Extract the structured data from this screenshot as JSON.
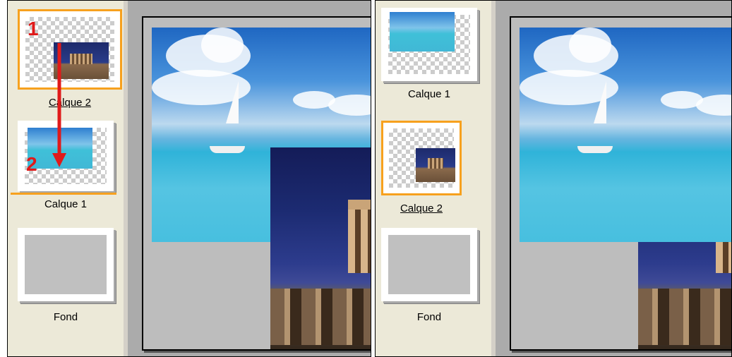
{
  "left_panel": {
    "layers": [
      {
        "label": "Calque 2",
        "active": true
      },
      {
        "label": "Calque 1",
        "active": false
      },
      {
        "label": "Fond",
        "active": false
      }
    ],
    "annotation": {
      "step1": "1",
      "step2": "2",
      "arrow_color": "#e01a1a"
    }
  },
  "right_panel": {
    "layers": [
      {
        "label": "Calque 1",
        "active": false
      },
      {
        "label": "Calque 2",
        "active": true
      },
      {
        "label": "Fond",
        "active": false
      }
    ]
  },
  "colors": {
    "selection": "#f7a11e",
    "panel_bg": "#ece9d8",
    "canvas_bg": "#ababab"
  }
}
